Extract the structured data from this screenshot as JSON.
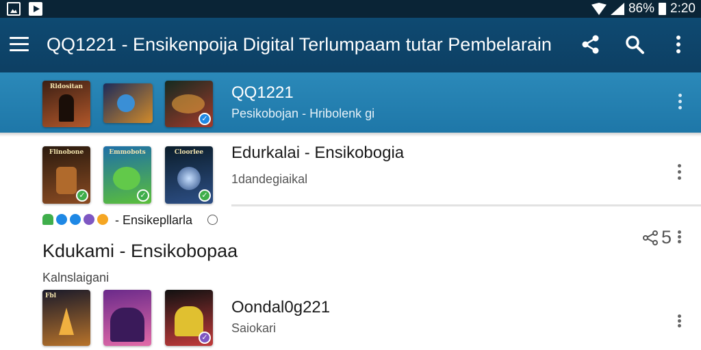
{
  "status_bar": {
    "battery": "86%",
    "time": "2:20",
    "icons": [
      "image-icon",
      "play-store-icon",
      "wifi-icon",
      "signal-icon",
      "battery-icon"
    ]
  },
  "app_bar": {
    "title": "QQ1221 - Ensikenpoija Digital Terlumpaam tutar Pembelarain",
    "actions": [
      "share-icon",
      "search-icon",
      "more-vert-icon"
    ]
  },
  "rows": [
    {
      "title": "QQ1221",
      "subtitle": "Pesikobojan - Hribolenk gi",
      "thumbs": [
        {
          "caption": "Rldositan",
          "colors": [
            "#3b1f14",
            "#b4582a"
          ]
        },
        {
          "caption": "",
          "colors": [
            "#1b2a5a",
            "#d28b2a"
          ]
        },
        {
          "caption": "",
          "colors": [
            "#142a20",
            "#a33a2a"
          ],
          "badge": "check"
        }
      ]
    },
    {
      "title": "Edurkalai - Ensikobogia",
      "subtitle": "1dandegiaikal",
      "thumbs": [
        {
          "caption": "Flinobone",
          "colors": [
            "#2a1a0e",
            "#8a4b22"
          ],
          "badge": "check"
        },
        {
          "caption": "Emmobots",
          "colors": [
            "#1e6fa8",
            "#5bbf3a"
          ],
          "badge": "check"
        },
        {
          "caption": "Cloorlee",
          "colors": [
            "#0b1d2a",
            "#2d4f86"
          ],
          "badge": "check"
        }
      ]
    }
  ],
  "rating_line": {
    "text": "- Ensikepllarla",
    "dot_colors": [
      "#3fae4b",
      "#1e88e5",
      "#1e88e5",
      "#7e57c2",
      "#f5a623"
    ]
  },
  "section": {
    "title": "Kdukami - Ensikobopaa",
    "subtitle": "Kalnslaigani",
    "share_count": "5"
  },
  "bottom_row": {
    "title": "Oondal0g221",
    "subtitle": "Saiokari",
    "thumbs": [
      {
        "caption": "Fbl",
        "colors": [
          "#1a1a2a",
          "#b8732a"
        ]
      },
      {
        "caption": "",
        "colors": [
          "#6a2a8a",
          "#e36aa8"
        ]
      },
      {
        "caption": "",
        "colors": [
          "#111111",
          "#c23a3a"
        ],
        "badge": "violet"
      }
    ]
  }
}
